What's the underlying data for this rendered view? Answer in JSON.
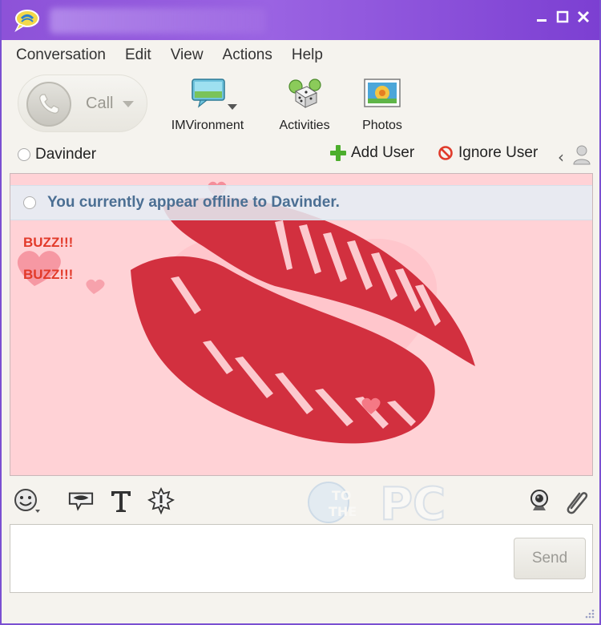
{
  "window": {
    "controls": [
      "minimize",
      "maximize",
      "close"
    ]
  },
  "menu": {
    "items": [
      "Conversation",
      "Edit",
      "View",
      "Actions",
      "Help"
    ]
  },
  "toolbar": {
    "call_label": "Call",
    "imvironment_label": "IMVironment",
    "activities_label": "Activities",
    "photos_label": "Photos"
  },
  "contact": {
    "name": "Davinder",
    "add_user_label": "Add User",
    "ignore_user_label": "Ignore User"
  },
  "chat": {
    "offline_notice": "You currently appear offline to Davinder.",
    "messages": [
      "BUZZ!!!",
      "BUZZ!!!"
    ]
  },
  "watermark": {
    "line1": "TO",
    "line2": "THE",
    "big": "PC"
  },
  "input": {
    "value": "",
    "send_label": "Send"
  },
  "colors": {
    "titlebar": "#8d52d8",
    "chat_background": "#ffd2d6",
    "kiss": "#d2303f",
    "buzz_text": "#e23a2a",
    "offline_text": "#4b6f93"
  },
  "icons": {
    "app": "yahoo-messenger-icon",
    "call": "phone-icon",
    "imvironment": "imvironment-icon",
    "activities": "dice-icon",
    "photos": "photo-icon",
    "add_user": "plus-icon",
    "ignore_user": "ban-icon",
    "emoticons": "smiley-icon",
    "audibles": "lips-icon",
    "text_format": "text-format-icon",
    "buzz": "buzz-icon",
    "webcam": "webcam-icon",
    "attach": "paperclip-icon"
  }
}
